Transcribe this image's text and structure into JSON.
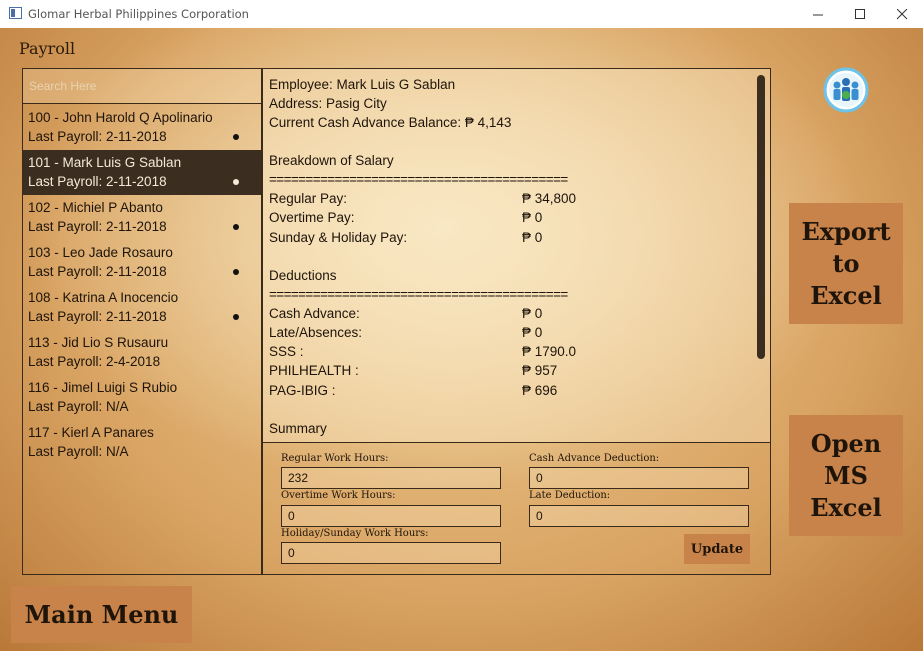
{
  "window": {
    "title": "Glomar Herbal Philippines Corporation"
  },
  "section": {
    "title": "Payroll"
  },
  "search": {
    "placeholder": "Search Here"
  },
  "employees": [
    {
      "name": "100 - John Harold Q Apolinario",
      "last": "Last Payroll: 2-11-2018",
      "dot": true
    },
    {
      "name": "101 - Mark Luis G Sablan",
      "last": "Last Payroll: 2-11-2018",
      "dot": true,
      "selected": true
    },
    {
      "name": "102 - Michiel P Abanto",
      "last": "Last Payroll: 2-11-2018",
      "dot": true
    },
    {
      "name": "103 - Leo Jade  Rosauro",
      "last": "Last Payroll: 2-11-2018",
      "dot": true
    },
    {
      "name": "108 - Katrina A Inocencio",
      "last": "Last Payroll: 2-11-2018",
      "dot": true
    },
    {
      "name": "113 - Jid Lio S Rusauru",
      "last": "Last Payroll: 2-4-2018",
      "dot": false
    },
    {
      "name": "116 - Jimel Luigi S Rubio",
      "last": "Last Payroll: N/A",
      "dot": false
    },
    {
      "name": "117 - Kierl A Panares",
      "last": "Last Payroll: N/A",
      "dot": false
    }
  ],
  "details": {
    "employee": "Employee: Mark Luis G Sablan",
    "address": "Address: Pasig City",
    "cash_balance": "Current Cash Advance Balance: ₱ 4,143",
    "salary_heading": "Breakdown of Salary",
    "separator": "=========================================",
    "regular_label": "Regular Pay:",
    "regular_value": "₱ 34,800",
    "overtime_label": "Overtime Pay:",
    "overtime_value": "₱ 0",
    "holiday_label": "Sunday & Holiday Pay:",
    "holiday_value": "₱ 0",
    "deductions_heading": "Deductions",
    "cash_adv_label": "Cash Advance:",
    "cash_adv_value": "₱ 0",
    "late_label": "Late/Absences:",
    "late_value": "₱ 0",
    "sss_label": "SSS :",
    "sss_value": "₱ 1790.0",
    "philhealth_label": "PHILHEALTH :",
    "philhealth_value": "₱ 957",
    "pagibig_label": "PAG-IBIG :",
    "pagibig_value": "₱ 696",
    "summary_heading": "Summary"
  },
  "form": {
    "regular_hours_label": "Regular Work Hours:",
    "regular_hours_value": "232",
    "overtime_hours_label": "Overtime Work Hours:",
    "overtime_hours_value": "0",
    "holiday_hours_label": "Holiday/Sunday Work Hours:",
    "holiday_hours_value": "0",
    "cash_deduction_label": "Cash Advance Deduction:",
    "cash_deduction_value": "0",
    "late_deduction_label": "Late Deduction:",
    "late_deduction_value": "0",
    "update_label": "Update"
  },
  "buttons": {
    "export_l1": "Export",
    "export_l2": "to",
    "export_l3": "Excel",
    "open_l1": "Open",
    "open_l2": "MS",
    "open_l3": "Excel",
    "main_menu": "Main Menu"
  },
  "icons": {
    "window": "app-window-icon",
    "people": "people-group-icon"
  },
  "colors": {
    "button": "#c8834a",
    "selected_row": "#3b2d1f",
    "text": "#1e140a"
  }
}
